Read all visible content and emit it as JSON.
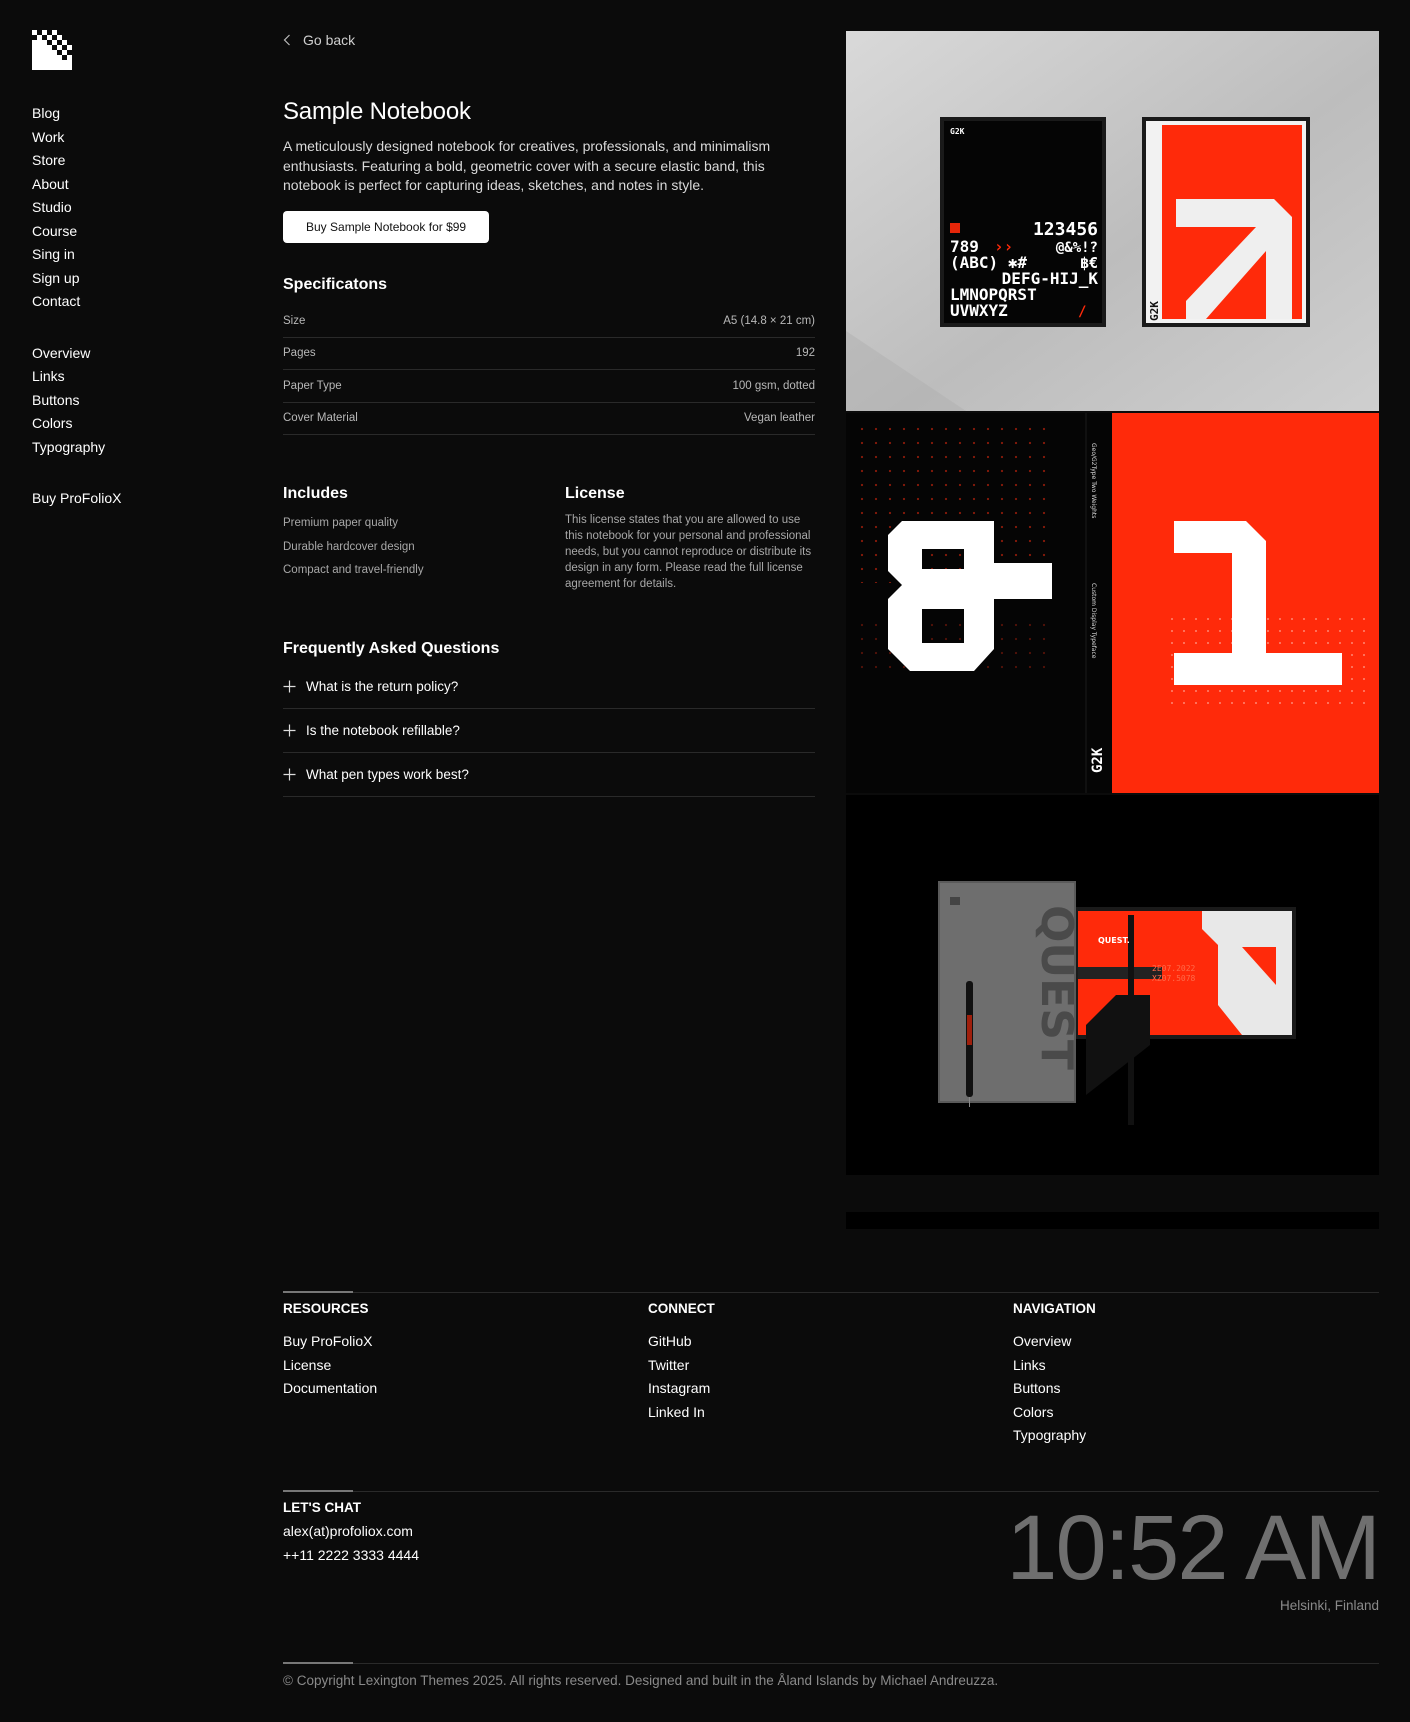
{
  "sidebar": {
    "primary": [
      "Blog",
      "Work",
      "Store",
      "About",
      "Studio",
      "Course",
      "Sing in",
      "Sign up",
      "Contact"
    ],
    "secondary": [
      "Overview",
      "Links",
      "Buttons",
      "Colors",
      "Typography"
    ],
    "cta": "Buy ProFolioX"
  },
  "back_label": "Go back",
  "product": {
    "title": "Sample Notebook",
    "description": "A meticulously designed notebook for creatives, professionals, and minimalism enthusiasts. Featuring a bold, geometric cover with a secure elastic band, this notebook is perfect for capturing ideas, sketches, and notes in style.",
    "buy_label": "Buy Sample Notebook for $99"
  },
  "specs": {
    "title": "Specificatons",
    "rows": [
      {
        "label": "Size",
        "value": "A5 (14.8 × 21 cm)"
      },
      {
        "label": "Pages",
        "value": "192"
      },
      {
        "label": "Paper Type",
        "value": "100 gsm, dotted"
      },
      {
        "label": "Cover Material",
        "value": "Vegan leather"
      }
    ]
  },
  "includes": {
    "title": "Includes",
    "items": [
      "Premium paper quality",
      "Durable hardcover design",
      "Compact and travel-friendly"
    ]
  },
  "license": {
    "title": "License",
    "text": "This license states that you are allowed to use this notebook for your personal and professional needs, but you cannot reproduce or distribute its design in any form. Please read the full license agreement for details."
  },
  "faq": {
    "title": "Frequently Asked Questions",
    "items": [
      "What is the return policy?",
      "Is the notebook refillable?",
      "What pen types work best?"
    ]
  },
  "gallery": {
    "poster_black": {
      "brand": "G2K",
      "line1": "123456",
      "line2": "789",
      "line2b": "@&%!?",
      "line3": "(ABC) ✱#",
      "line3b": "฿€",
      "line4": "DEFG-HIJ_K",
      "line5": "LMNOPQRST",
      "line6": "UVWXYZ"
    },
    "poster_red": {
      "brand": "G2K"
    },
    "typeface": {
      "brand": "G2K",
      "side_top": "Geo/G2Type Two Weights",
      "side_mid": "Custom Display Typeface"
    },
    "notebook": {
      "word": "QUEST",
      "tag": "QUEST.",
      "code1": "2E07.2022",
      "code2": "XZ07.5078"
    }
  },
  "footer": {
    "resources": {
      "title": "RESOURCES",
      "links": [
        "Buy ProFolioX",
        "License",
        "Documentation"
      ]
    },
    "connect": {
      "title": "CONNECT",
      "links": [
        "GitHub",
        "Twitter",
        "Instagram",
        "Linked In"
      ]
    },
    "navigation": {
      "title": "NAVIGATION",
      "links": [
        "Overview",
        "Links",
        "Buttons",
        "Colors",
        "Typography"
      ]
    },
    "chat": {
      "title": "LET'S CHAT",
      "email": "alex(at)profoliox.com",
      "phone": "++11 2222 3333 4444"
    },
    "clock": "10:52 AM",
    "city": "Helsinki, Finland",
    "copyright": "© Copyright Lexington Themes 2025. All rights reserved. Designed and built in the Åland Islands by Michael Andreuzza."
  },
  "colors": {
    "accent_red": "#ff2a0a",
    "background": "#0b0b0b",
    "text": "#ffffff",
    "muted": "#a8a8a8"
  }
}
